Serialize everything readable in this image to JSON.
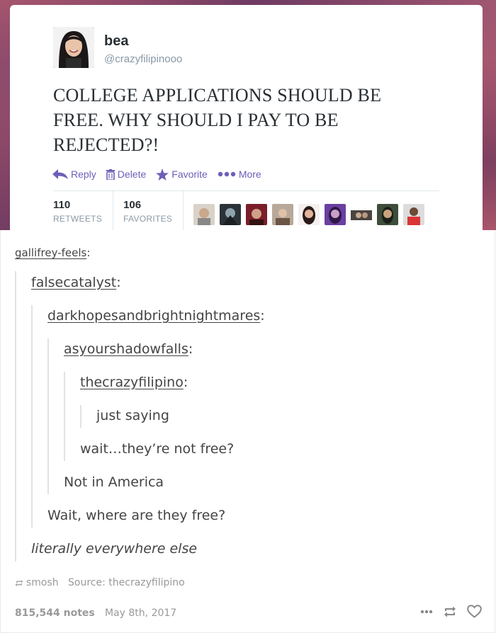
{
  "tweet": {
    "name": "bea",
    "handle": "@crazyfilipinooo",
    "text": "COLLEGE APPLICATIONS SHOULD BE FREE. WHY SHOULD I PAY TO BE REJECTED?!",
    "actions": {
      "reply": "Reply",
      "delete": "Delete",
      "favorite": "Favorite",
      "more": "More"
    },
    "stats": {
      "retweets_count": "110",
      "retweets_label": "RETWEETS",
      "favorites_count": "106",
      "favorites_label": "FAVORITES"
    },
    "accent_color": "#6c5fb8"
  },
  "thread": {
    "users": {
      "u1": "gallifrey-feels",
      "u2": "falsecatalyst",
      "u3": "darkhopesandbrightnightmares",
      "u4": "asyourshadowfalls",
      "u5": "thecrazyfilipino"
    },
    "colon": ":",
    "messages": {
      "m1": "just saying",
      "m2": "wait…they’re not free?",
      "m3": "Not in America",
      "m4": "Wait, where are they free?",
      "m5": "literally everywhere else"
    },
    "reblog_via": "smosh",
    "source_prefix": "Source:",
    "source_name": "thecrazyfilipino",
    "notes": "815,544 notes",
    "date": "May 8th, 2017"
  }
}
